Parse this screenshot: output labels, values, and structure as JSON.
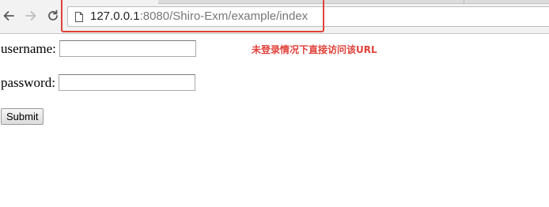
{
  "browser": {
    "url_host": "127.0.0.1",
    "url_path": ":8080/Shiro-Exm/example/index"
  },
  "form": {
    "username_label": "username:",
    "username_value": "",
    "password_label": "password:",
    "password_value": "",
    "submit_label": "Submit"
  },
  "annotation": {
    "text": "未登录情况下直接访问该URL",
    "color": "#e0423a"
  }
}
